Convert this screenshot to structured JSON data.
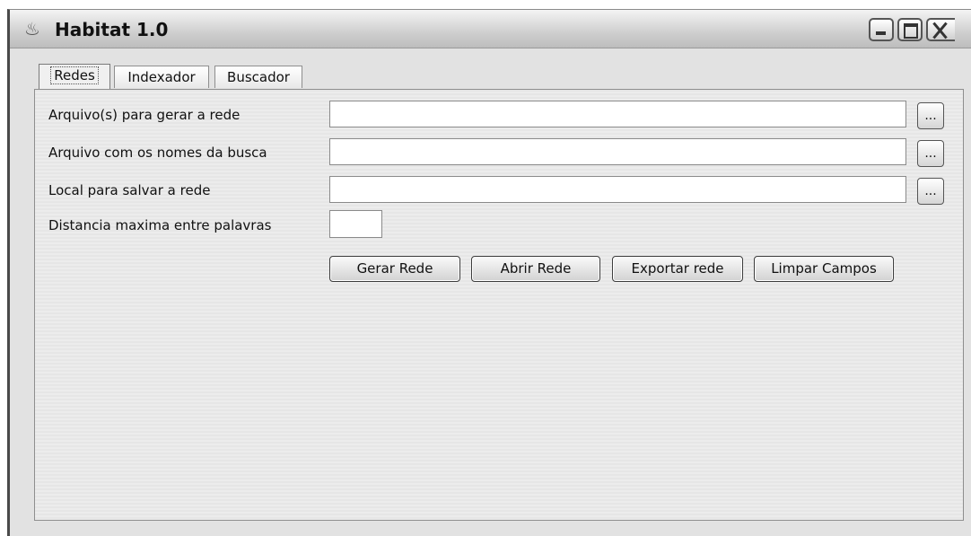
{
  "window": {
    "title": "Habitat 1.0",
    "icon": "habitat-app-icon"
  },
  "tabs": [
    {
      "label": "Redes",
      "active": true
    },
    {
      "label": "Indexador",
      "active": false
    },
    {
      "label": "Buscador",
      "active": false
    }
  ],
  "form": {
    "fields": [
      {
        "label": "Arquivo(s) para gerar a rede",
        "value": "",
        "browse_label": "..."
      },
      {
        "label": "Arquivo com os nomes da busca",
        "value": "",
        "browse_label": "..."
      },
      {
        "label": "Local para salvar a rede",
        "value": "",
        "browse_label": "..."
      }
    ],
    "distance": {
      "label": "Distancia maxima entre palavras",
      "value": ""
    }
  },
  "actions": {
    "gerar": "Gerar Rede",
    "abrir": "Abrir Rede",
    "exportar": "Exportar rede",
    "limpar": "Limpar Campos"
  }
}
